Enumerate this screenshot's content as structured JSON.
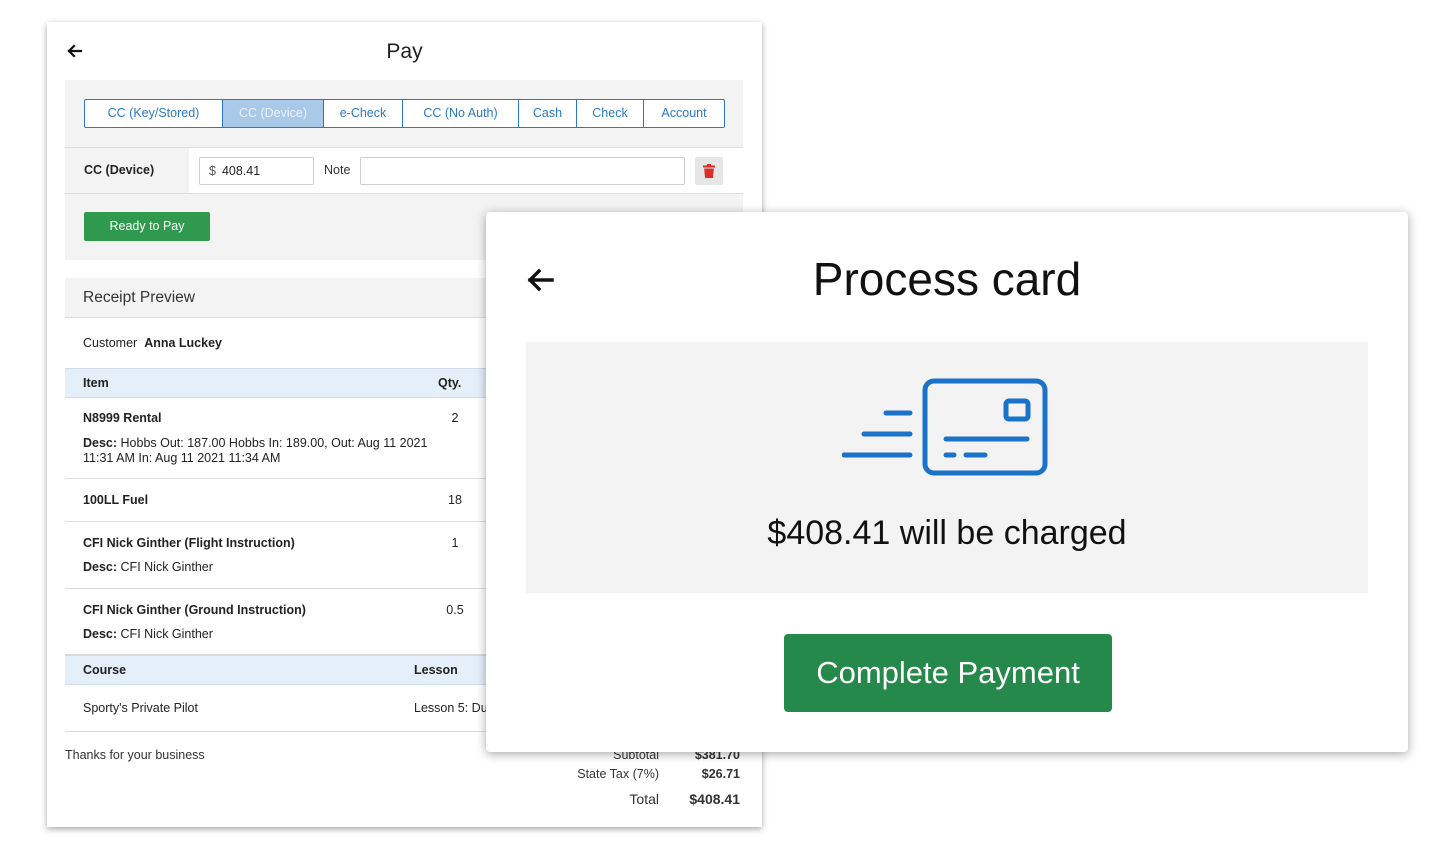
{
  "pay": {
    "title": "Pay",
    "tabs": [
      "CC (Key/Stored)",
      "CC (Device)",
      "e-Check",
      "CC (No Auth)",
      "Cash",
      "Check",
      "Account"
    ],
    "active_tab": "CC (Device)",
    "method_label": "CC (Device)",
    "currency_symbol": "$",
    "amount": "408.41",
    "note_label": "Note",
    "note_value": "",
    "ready_button": "Ready to Pay"
  },
  "receipt": {
    "title": "Receipt Preview",
    "customer_label": "Customer",
    "customer_name": "Anna Luckey",
    "columns": {
      "item": "Item",
      "qty": "Qty."
    },
    "items": [
      {
        "name": "N8999 Rental",
        "qty": "2",
        "desc_label": "Desc:",
        "desc": "Hobbs Out: 187.00 Hobbs In: 189.00, Out: Aug 11 2021 11:31 AM In: Aug 11 2021 11:34 AM"
      },
      {
        "name": "100LL Fuel",
        "qty": "18",
        "desc_label": "",
        "desc": ""
      },
      {
        "name": "CFI Nick Ginther (Flight Instruction)",
        "qty": "1",
        "desc_label": "Desc:",
        "desc": "CFI Nick Ginther"
      },
      {
        "name": "CFI Nick Ginther (Ground Instruction)",
        "qty": "0.5",
        "desc_label": "Desc:",
        "desc": "CFI Nick Ginther"
      }
    ],
    "course_columns": {
      "course": "Course",
      "lesson": "Lesson"
    },
    "course": {
      "name": "Sporty's Private Pilot",
      "lesson": "Lesson 5: Du"
    },
    "thanks": "Thanks for your business",
    "subtotal_label": "Subtotal",
    "subtotal": "$381.70",
    "tax_label": "State Tax (7%)",
    "tax": "$26.71",
    "total_label": "Total",
    "total": "$408.41"
  },
  "modal": {
    "title": "Process card",
    "charge_text": "$408.41 will be charged",
    "button": "Complete Payment",
    "accent_color": "#1a73c8",
    "button_color": "#24894a"
  },
  "icons": {
    "back": "arrow-left-icon",
    "trash": "trash-icon",
    "card": "credit-card-contactless-icon"
  }
}
